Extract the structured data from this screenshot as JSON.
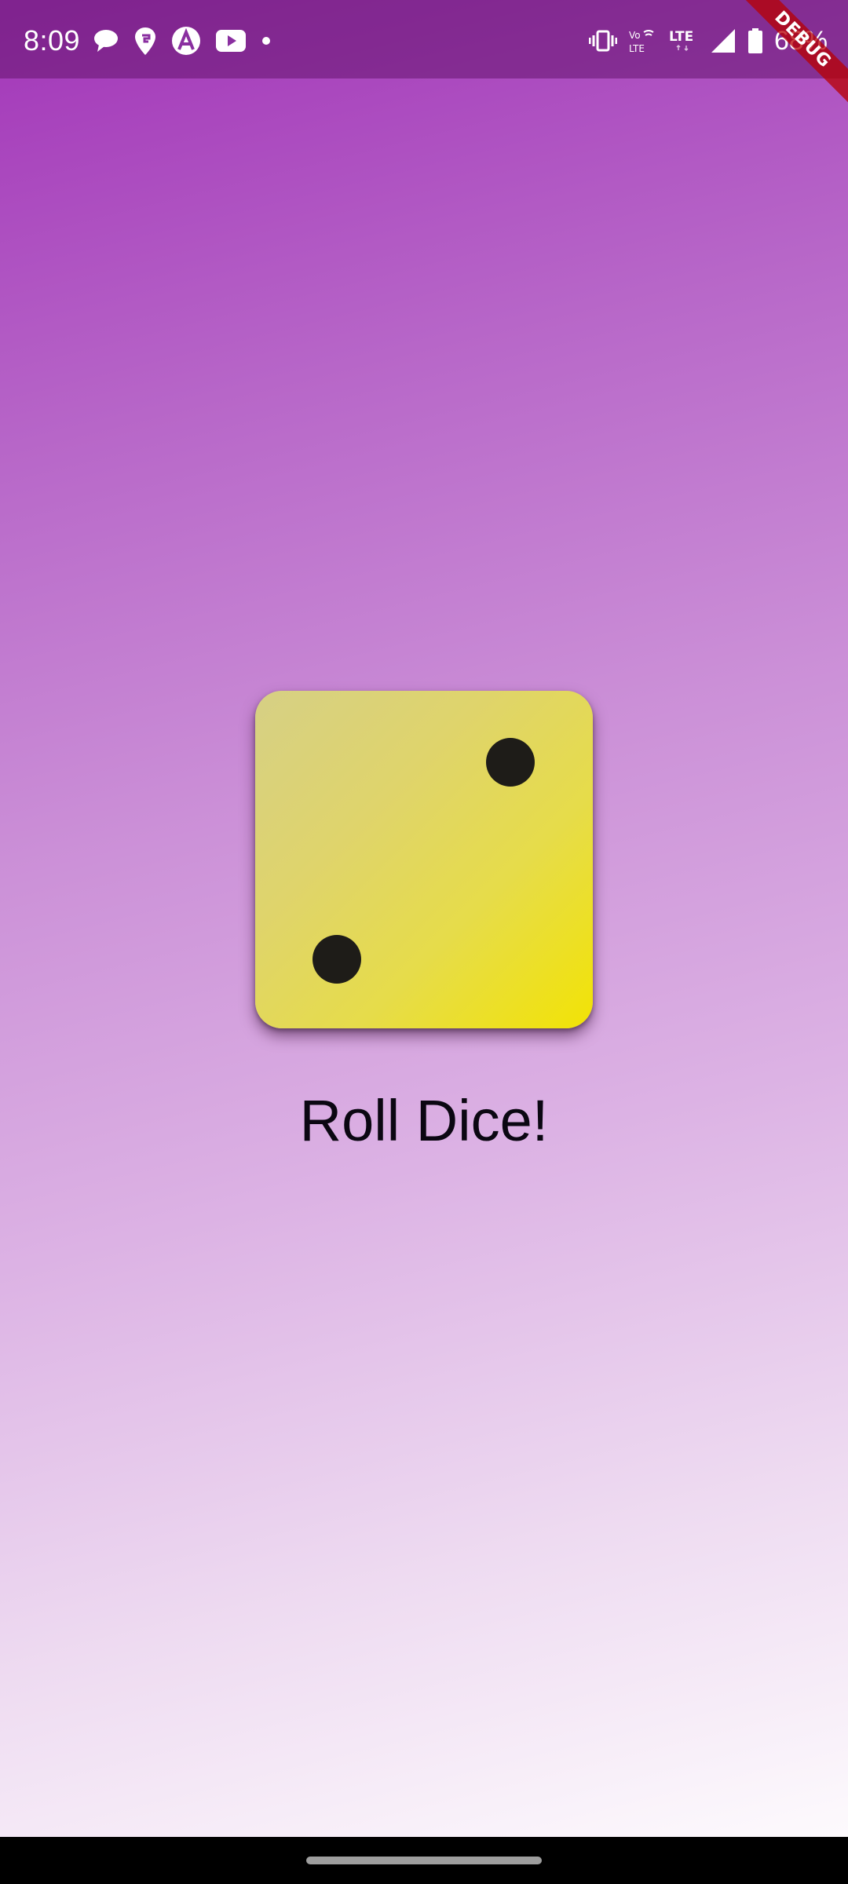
{
  "status_bar": {
    "time": "8:09",
    "battery_percent": "68%",
    "left_icons": [
      "messages-icon",
      "swiggy-icon",
      "arattai-icon",
      "youtube-icon",
      "dot-icon"
    ],
    "right_icons": [
      "vibrate-icon",
      "volte-icon",
      "lte-icon",
      "signal-icon",
      "battery-icon"
    ],
    "volte_label": "Vo LTE",
    "lte_label": "LTE"
  },
  "debug_banner": {
    "label": "DEBUG"
  },
  "dice": {
    "value": 2,
    "pip_color": "#1e1c18"
  },
  "main": {
    "roll_label": "Roll Dice!"
  },
  "theme": {
    "gradient_top": "#a235b8",
    "gradient_bottom": "#fdfafd",
    "dice_color": "#f2e305"
  }
}
